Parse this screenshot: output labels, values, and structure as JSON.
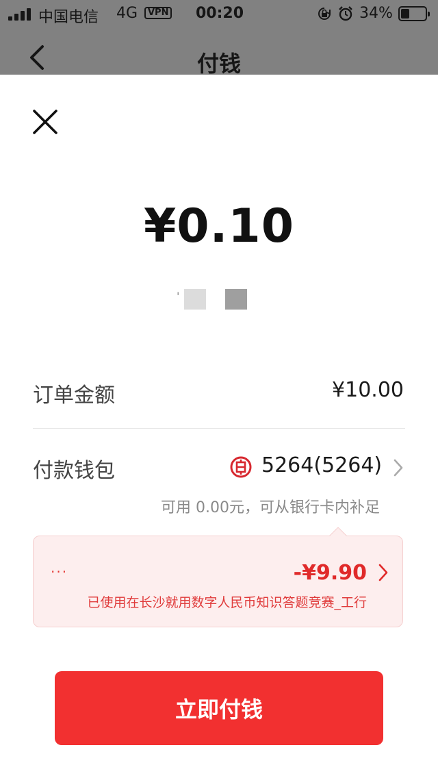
{
  "status_bar": {
    "carrier": "中国电信",
    "network": "4G",
    "vpn": "VPN",
    "time": "00:20",
    "battery_percent": "34%",
    "battery_level": 0.34
  },
  "nav": {
    "title": "付钱"
  },
  "payment": {
    "amount": "¥0.10",
    "order_label": "订单金额",
    "order_value": "¥10.00",
    "wallet_label": "付款钱包",
    "wallet_value": "5264(5264)",
    "available_note": "可用 0.00元，可从银行卡内补足"
  },
  "promo": {
    "dots": "···",
    "discount": "-¥9.90",
    "description": "已使用在长沙就用数字人民币知识答题竞赛_工行"
  },
  "button": {
    "pay_label": "立即付钱"
  },
  "colors": {
    "accent_red": "#f23030",
    "promo_bg": "#fdeeee",
    "bank_red": "#d7282f"
  }
}
